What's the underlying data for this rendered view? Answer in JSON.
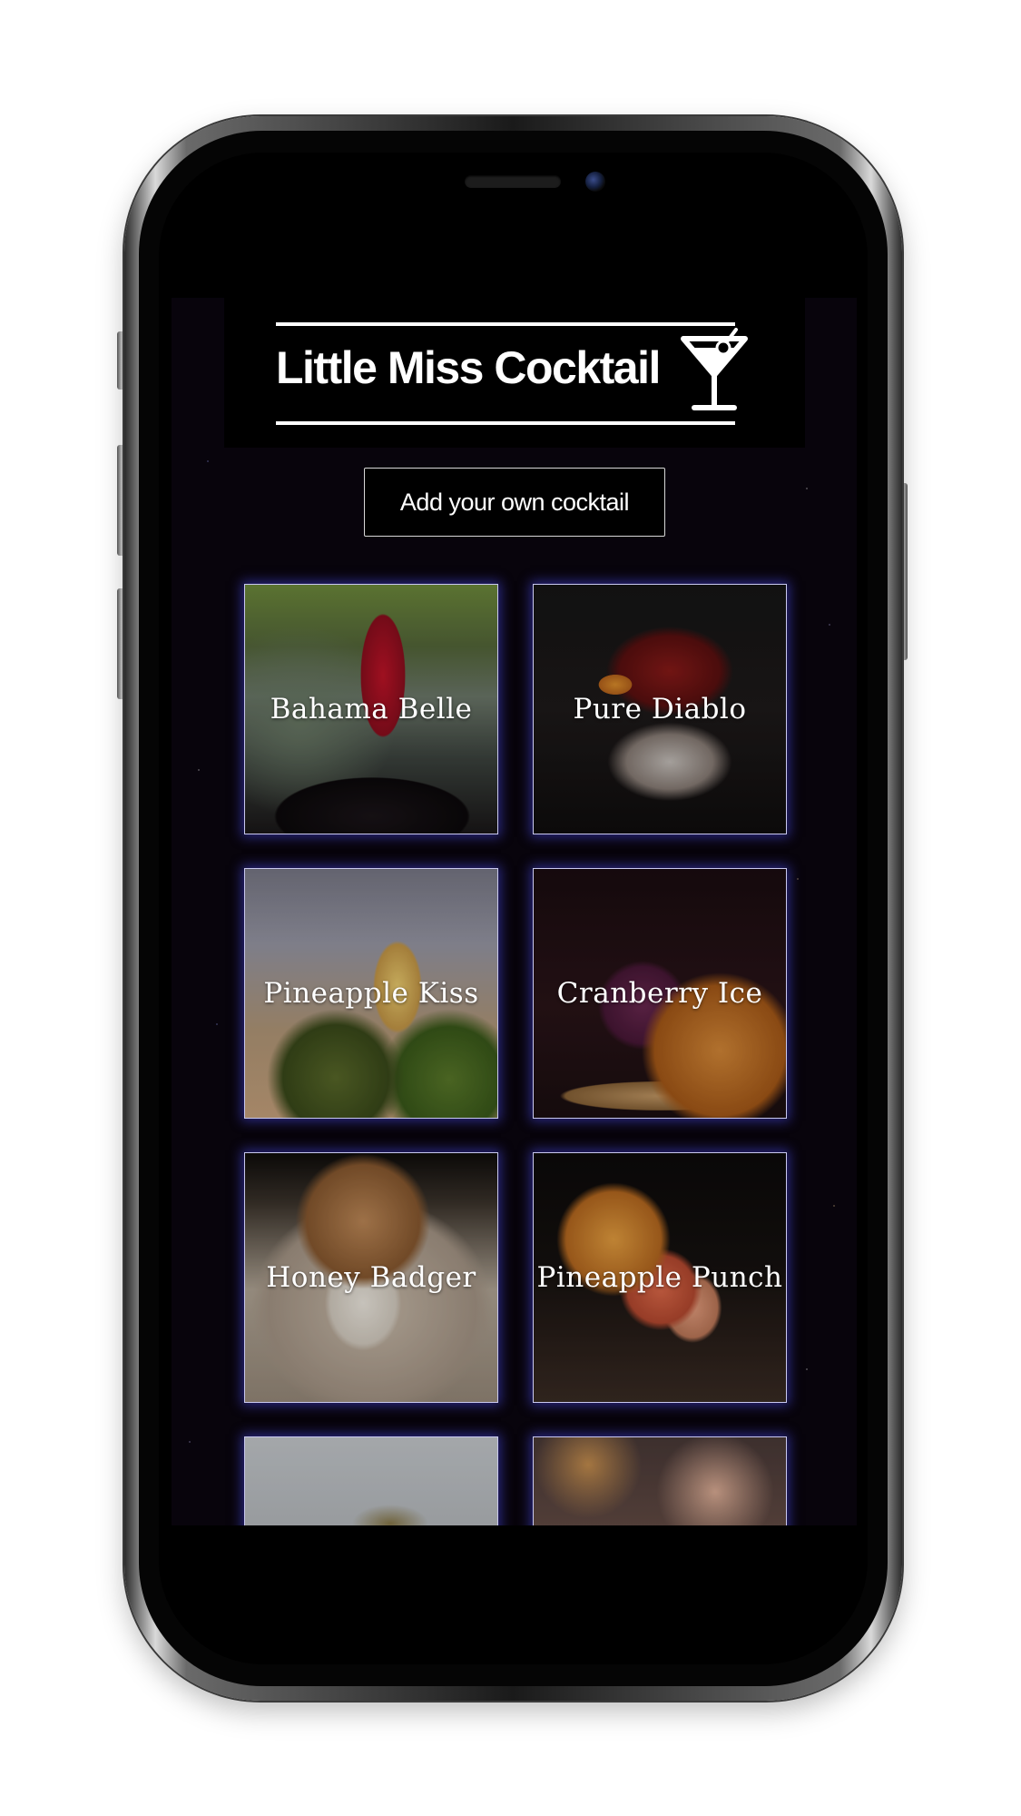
{
  "app": {
    "title": "Little Miss Cocktail",
    "logo_icon": "martini-glass-icon"
  },
  "actions": {
    "add_cocktail_label": "Add your own cocktail"
  },
  "cocktails": [
    {
      "name": "Bahama Belle"
    },
    {
      "name": "Pure Diablo"
    },
    {
      "name": "Pineapple Kiss"
    },
    {
      "name": "Cranberry Ice"
    },
    {
      "name": "Honey Badger"
    },
    {
      "name": "Pineapple Punch"
    },
    {
      "name": ""
    },
    {
      "name": ""
    }
  ],
  "colors": {
    "background": "#08040c",
    "header": "#000000",
    "text": "#ffffff",
    "card_glow": "#4646dc"
  }
}
